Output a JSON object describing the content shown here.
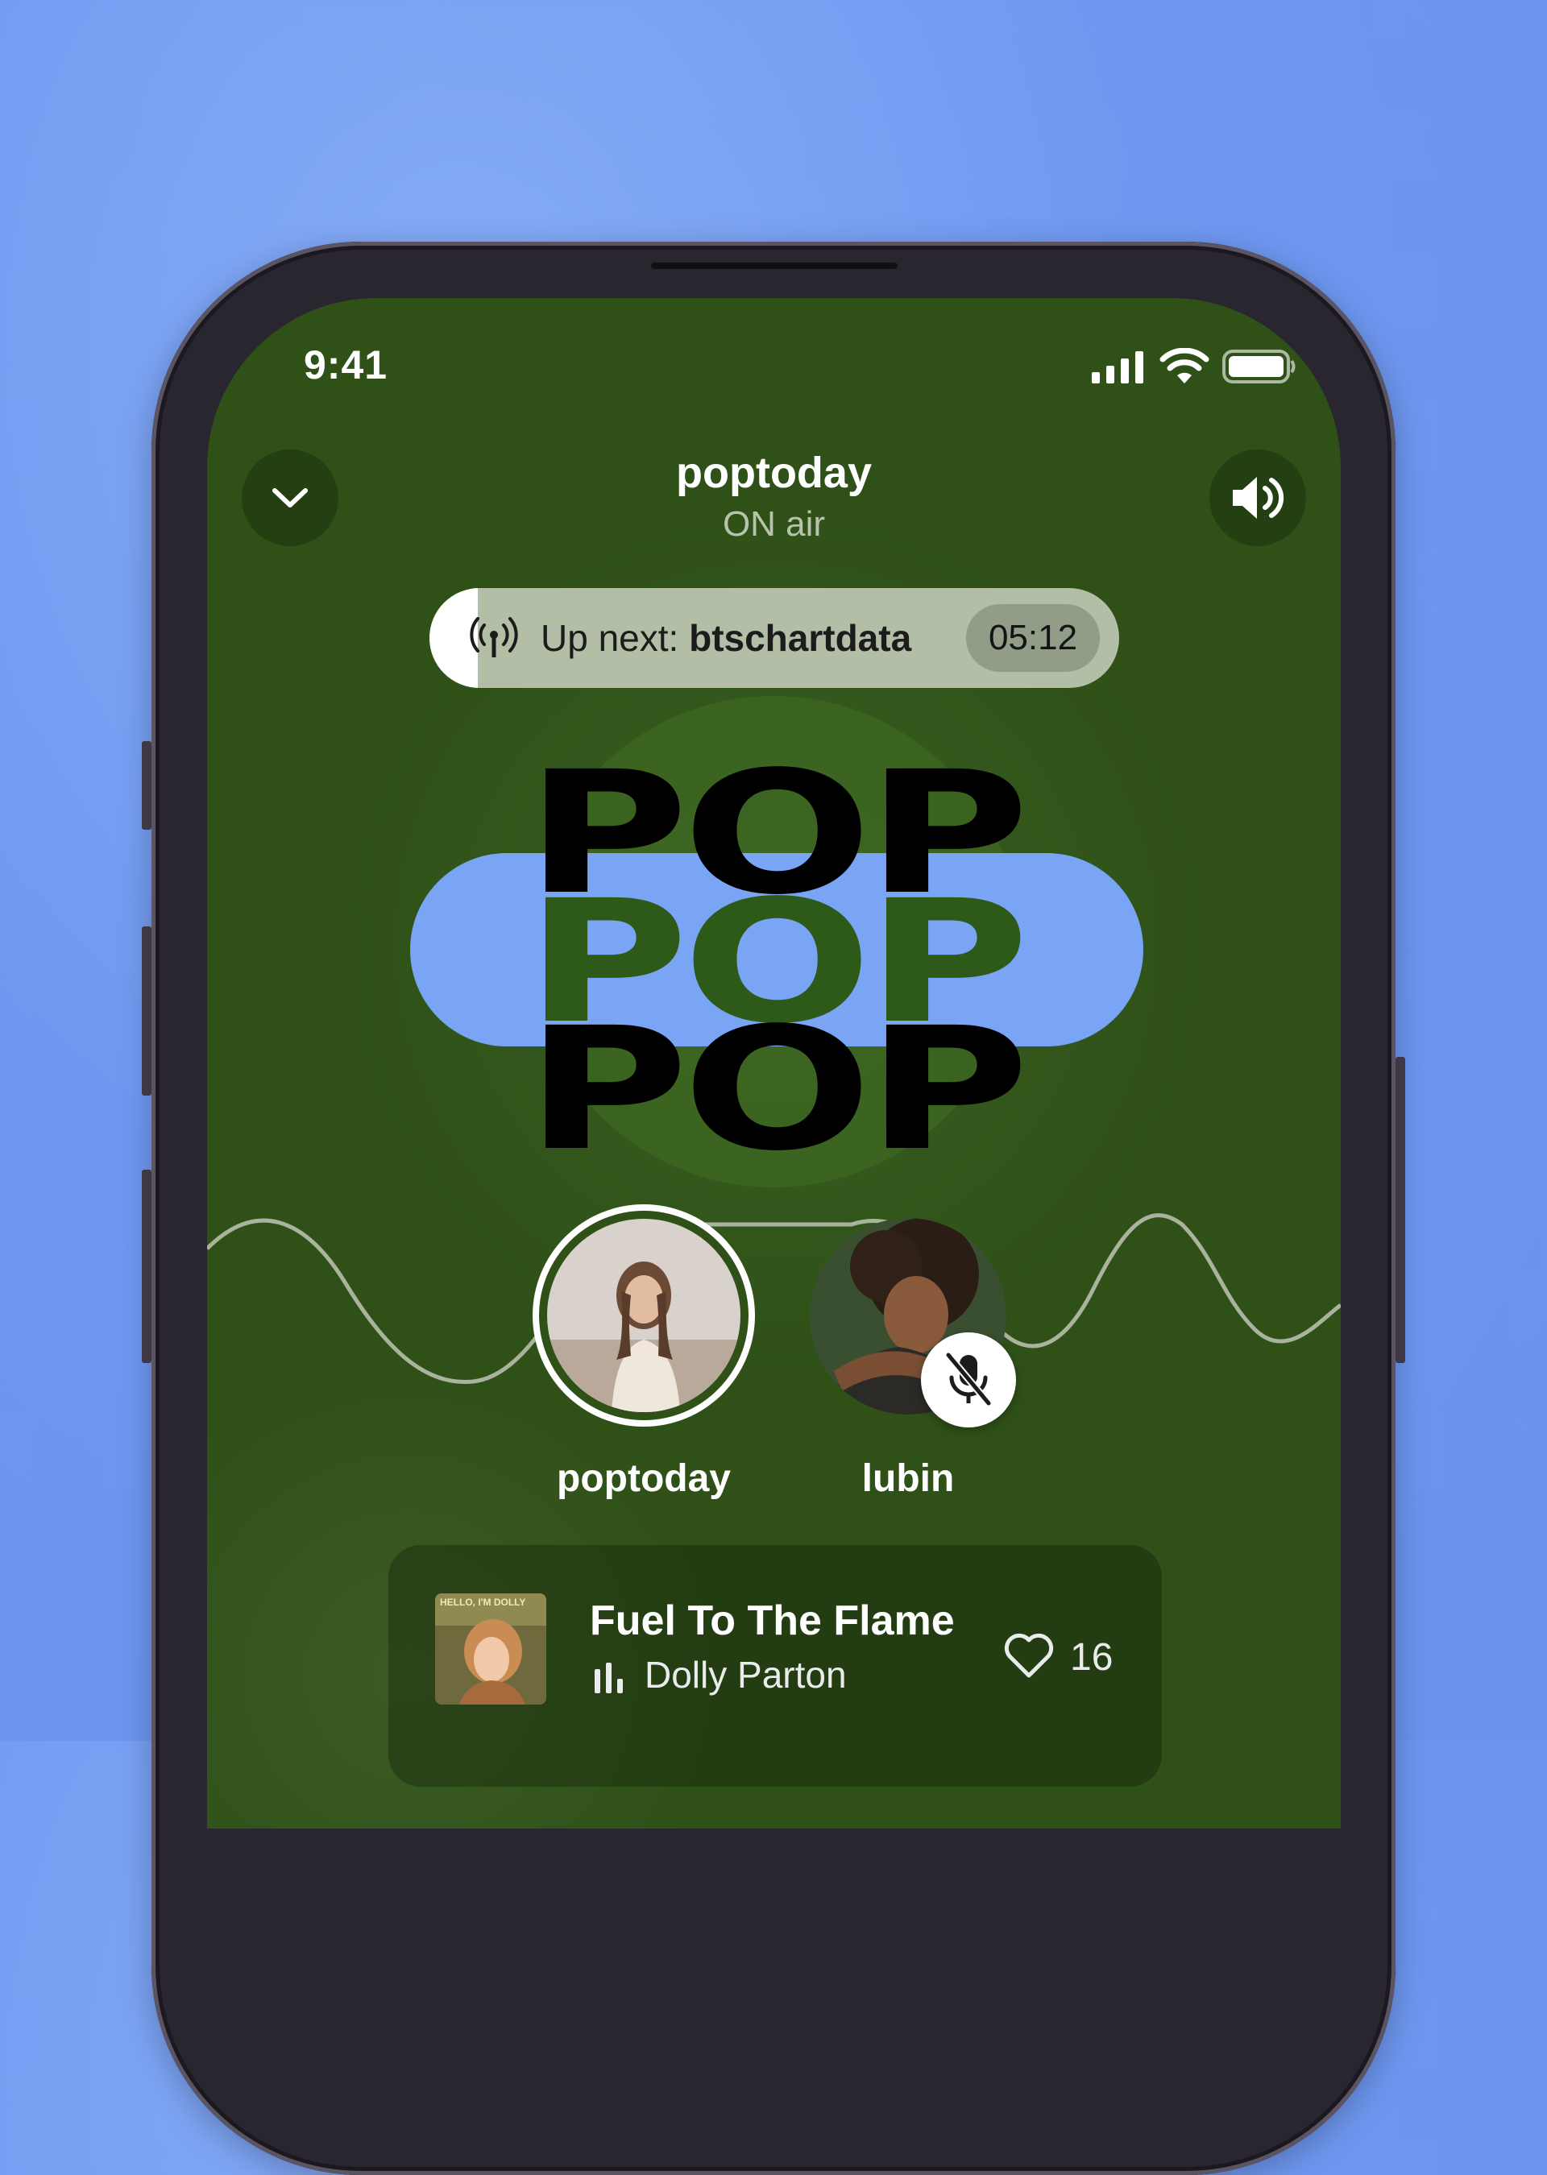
{
  "status_bar": {
    "time": "9:41"
  },
  "header": {
    "title": "poptoday",
    "subtitle": "ON air"
  },
  "up_next": {
    "label": "Up next: ",
    "host": "btschartdata",
    "timer": "05:12",
    "progress": 0.07
  },
  "cover": {
    "lines": [
      "POP",
      "POP",
      "POP"
    ]
  },
  "speakers": [
    {
      "name": "poptoday",
      "active": true,
      "muted": false
    },
    {
      "name": "lubin",
      "active": false,
      "muted": true
    }
  ],
  "now_playing": {
    "title": "Fuel To The Flame",
    "artist": "Dolly Parton",
    "likes": "16",
    "album_art_text": "HELLO, I'M DOLLY"
  },
  "colors": {
    "background": "#6f98f0",
    "screen": "#2f5118",
    "pill": "#7aa5f5",
    "accent_white": "#ffffff"
  },
  "icons": [
    "chevron-down-icon",
    "speaker-icon",
    "broadcast-icon",
    "mic-off-icon",
    "heart-icon",
    "equalizer-icon",
    "signal-icon",
    "wifi-icon",
    "battery-icon"
  ]
}
